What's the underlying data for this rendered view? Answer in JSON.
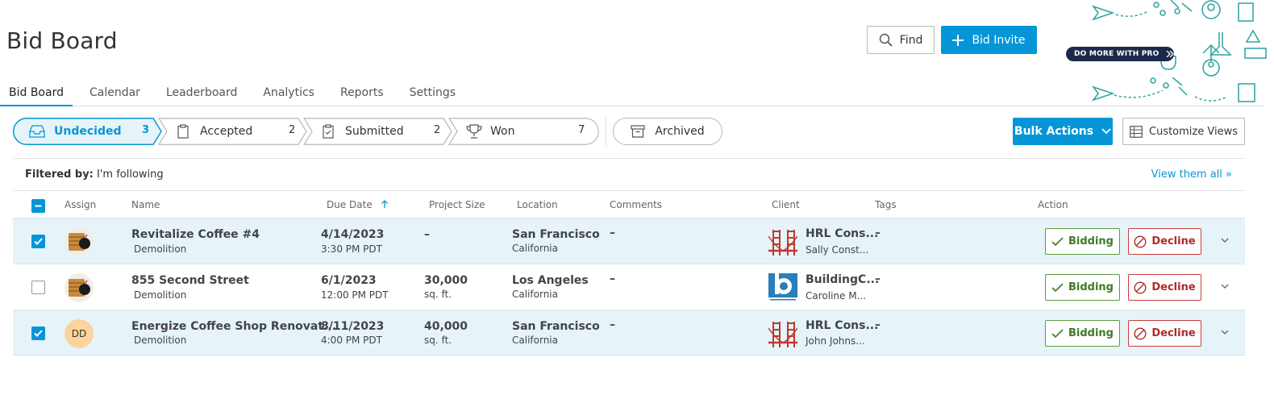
{
  "header": {
    "title": "Bid Board",
    "find_label": "Find",
    "invite_label": "Bid Invite",
    "promo_label": "DO MORE WITH PRO"
  },
  "tabs": [
    {
      "label": "Bid Board",
      "active": true
    },
    {
      "label": "Calendar",
      "active": false
    },
    {
      "label": "Leaderboard",
      "active": false
    },
    {
      "label": "Analytics",
      "active": false
    },
    {
      "label": "Reports",
      "active": false
    },
    {
      "label": "Settings",
      "active": false
    }
  ],
  "stages": [
    {
      "label": "Undecided",
      "count": "3",
      "icon": "inbox-icon",
      "active": true
    },
    {
      "label": "Accepted",
      "count": "2",
      "icon": "clipboard-icon",
      "active": false
    },
    {
      "label": "Submitted",
      "count": "2",
      "icon": "clipboard-check-icon",
      "active": false
    },
    {
      "label": "Won",
      "count": "7",
      "icon": "trophy-icon",
      "active": false
    }
  ],
  "archived_label": "Archived",
  "toolbar": {
    "bulk_label": "Bulk Actions",
    "customize_label": "Customize Views"
  },
  "filter": {
    "prefix": "Filtered by:",
    "value": "I'm following",
    "view_all": "View them all »"
  },
  "columns": {
    "assign": "Assign",
    "name": "Name",
    "due_date": "Due Date",
    "project_size": "Project Size",
    "location": "Location",
    "comments": "Comments",
    "client": "Client",
    "tags": "Tags",
    "action": "Action"
  },
  "rows": [
    {
      "selected": true,
      "avatar": "photo",
      "name": "Revitalize Coffee #4",
      "trade": "Demolition",
      "due_date": "4/14/2023",
      "due_time": "3:30 PM PDT",
      "size": "–",
      "size_unit": "",
      "city": "San Francisco",
      "state": "California",
      "comments": "–",
      "client": "HRL Cons...",
      "client_contact": "Sally Const...",
      "client_logo": "bridge-logo",
      "tags": "–",
      "bidding_label": "Bidding",
      "decline_label": "Decline"
    },
    {
      "selected": false,
      "avatar": "photo",
      "name": "855 Second Street",
      "trade": "Demolition",
      "due_date": "6/1/2023",
      "due_time": "12:00 PM PDT",
      "size": "30,000",
      "size_unit": "sq. ft.",
      "city": "Los Angeles",
      "state": "California",
      "comments": "–",
      "client": "BuildingC...",
      "client_contact": "Caroline M...",
      "client_logo": "company-logo",
      "tags": "–",
      "bidding_label": "Bidding",
      "decline_label": "Decline"
    },
    {
      "selected": true,
      "avatar": "DD",
      "name": "Energize Coffee Shop Renovat...",
      "trade": "Demolition",
      "due_date": "8/11/2023",
      "due_time": "4:00 PM PDT",
      "size": "40,000",
      "size_unit": "sq. ft.",
      "city": "San Francisco",
      "state": "California",
      "comments": "–",
      "client": "HRL Cons...",
      "client_contact": "John Johns...",
      "client_logo": "bridge-logo",
      "tags": "–",
      "bidding_label": "Bidding",
      "decline_label": "Decline"
    }
  ],
  "colors": {
    "accent": "#0696d7",
    "selected_row": "#e6f4fa",
    "bidding": "#3f7a26",
    "decline": "#b02a2a",
    "promo": "#1c2a4a"
  }
}
